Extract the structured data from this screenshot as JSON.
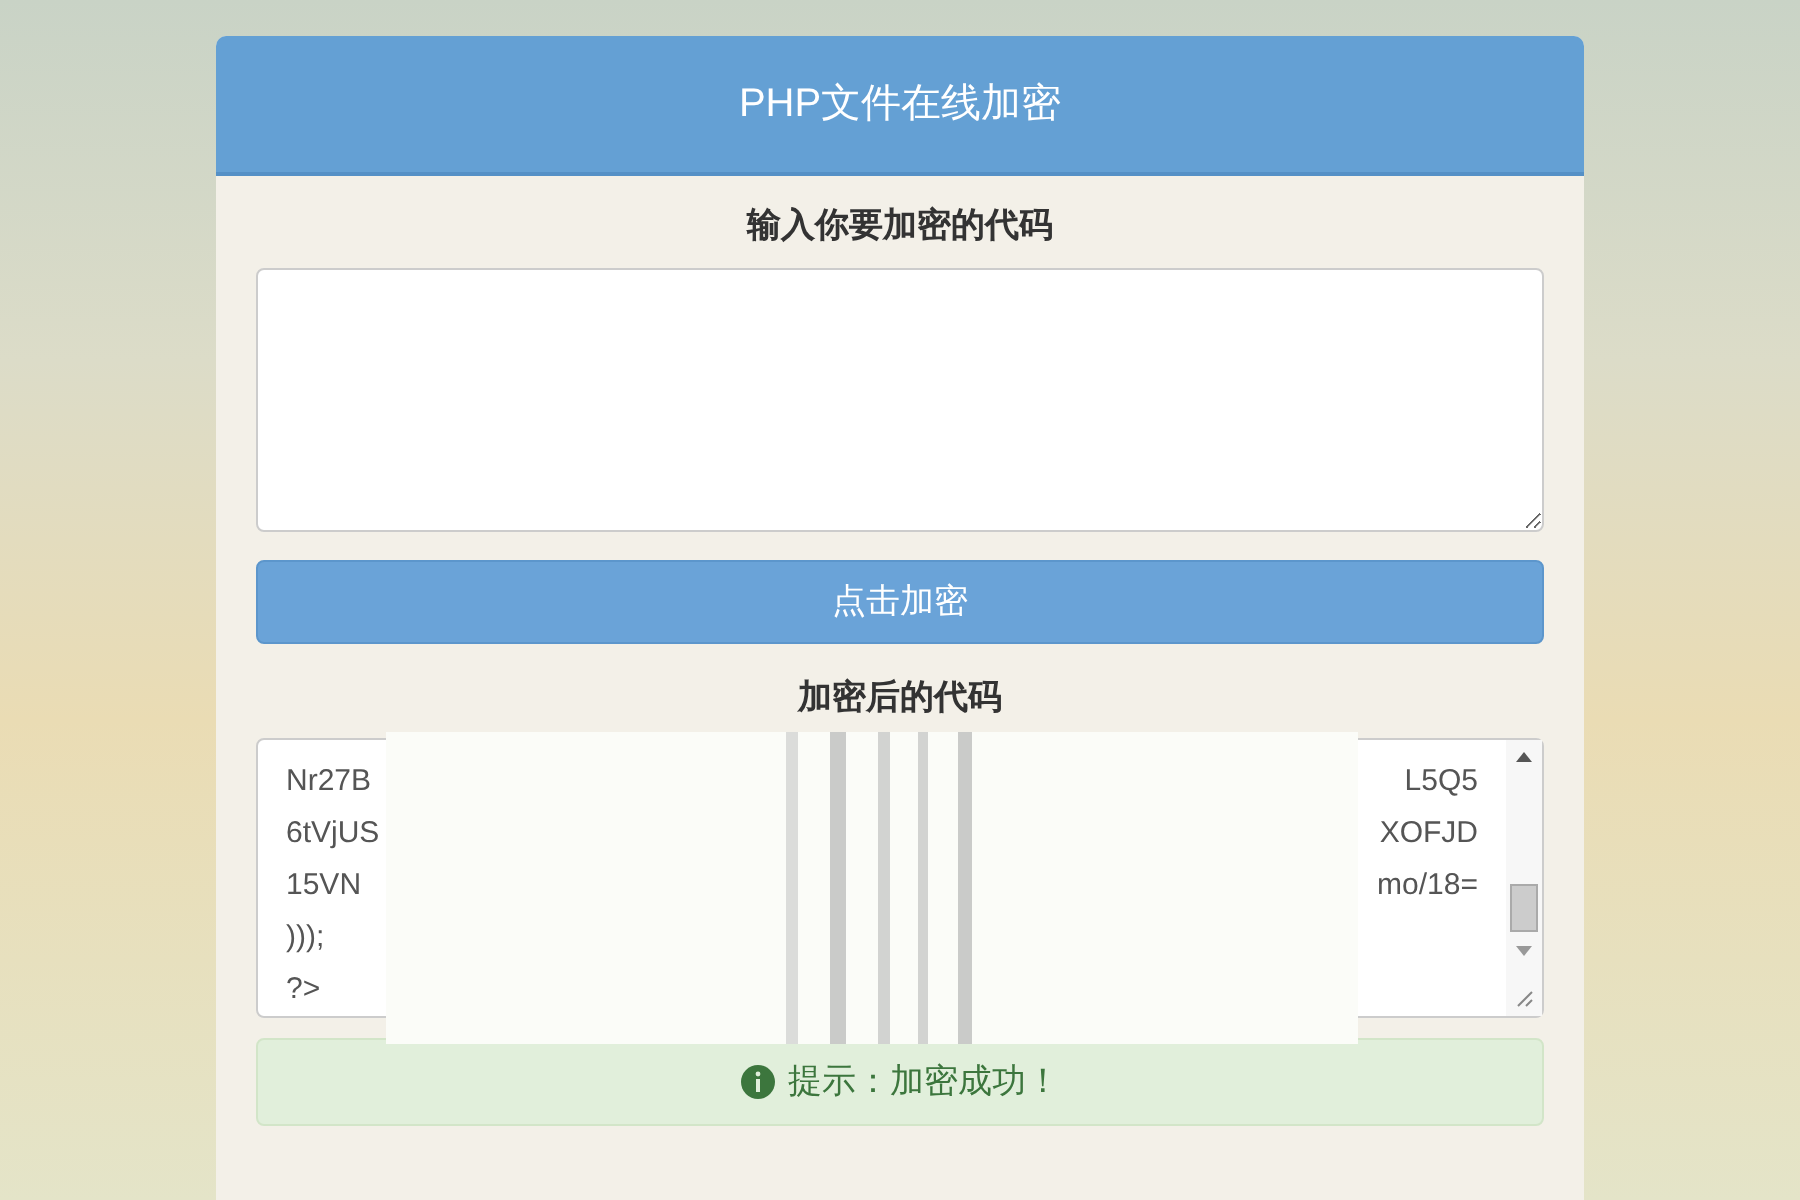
{
  "title": "PHP文件在线加密",
  "input": {
    "label": "输入你要加密的代码"
  },
  "encrypt_button": "点击加密",
  "output": {
    "label": "加密后的代码",
    "lines": [
      {
        "start": "Nr27B",
        "end": "L5Q5"
      },
      {
        "start": "6tVjUS",
        "end": "XOFJD"
      },
      {
        "start": "15VN",
        "end": "mo/18="
      },
      {
        "start": ")));"
      },
      {
        "start": "?>"
      }
    ]
  },
  "alert": {
    "text": "提示：加密成功！"
  }
}
